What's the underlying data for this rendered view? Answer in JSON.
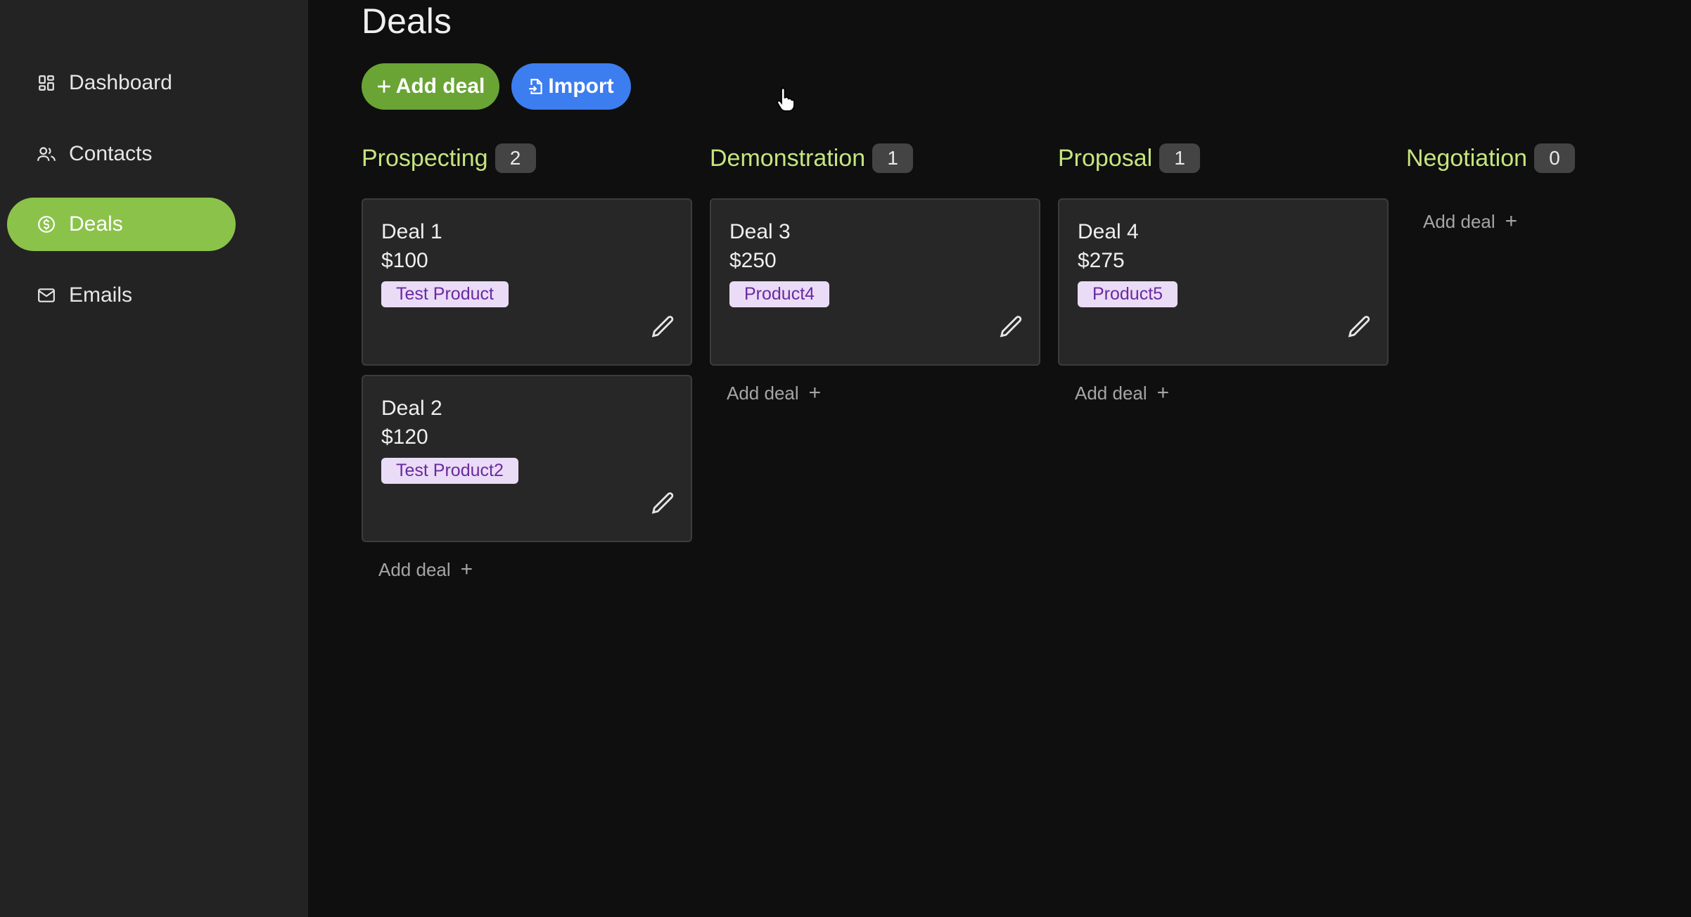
{
  "sidebar": {
    "items": [
      {
        "label": "Dashboard",
        "icon": "grid-icon",
        "active": false
      },
      {
        "label": "Contacts",
        "icon": "users-icon",
        "active": false
      },
      {
        "label": "Deals",
        "icon": "dollar-circle-icon",
        "active": true
      },
      {
        "label": "Emails",
        "icon": "mail-icon",
        "active": false
      }
    ]
  },
  "header": {
    "title": "Deals",
    "add_deal_label": "Add deal",
    "import_label": "Import"
  },
  "board": {
    "add_deal_label": "Add deal",
    "columns": [
      {
        "title": "Prospecting",
        "count": "2",
        "deals": [
          {
            "name": "Deal 1",
            "amount": "$100",
            "product": "Test Product"
          },
          {
            "name": "Deal 2",
            "amount": "$120",
            "product": "Test Product2"
          }
        ]
      },
      {
        "title": "Demonstration",
        "count": "1",
        "deals": [
          {
            "name": "Deal 3",
            "amount": "$250",
            "product": "Product4"
          }
        ]
      },
      {
        "title": "Proposal",
        "count": "1",
        "deals": [
          {
            "name": "Deal 4",
            "amount": "$275",
            "product": "Product5"
          }
        ]
      },
      {
        "title": "Negotiation",
        "count": "0",
        "deals": []
      }
    ]
  },
  "colors": {
    "active_nav": "#8bc34a",
    "add_button": "#6aa434",
    "import_button": "#3c7df0",
    "column_title": "#c5e57f",
    "tag_bg": "#eadcf7",
    "tag_text": "#6a2aa0"
  }
}
